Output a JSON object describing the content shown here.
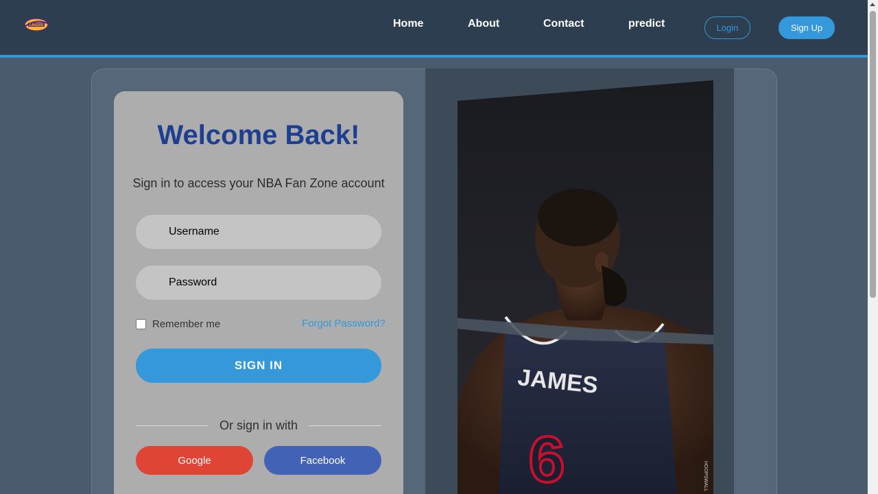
{
  "nav": {
    "links": [
      "Home",
      "About",
      "Contact",
      "predict"
    ],
    "login_label": "Login",
    "signup_label": "Sign Up"
  },
  "login_form": {
    "title": "Welcome Back!",
    "subtitle": "Sign in to access your NBA Fan Zone account",
    "username_placeholder": "Username",
    "password_placeholder": "Password",
    "remember_label": "Remember me",
    "forgot_label": "Forgot Password?",
    "signin_label": "SIGN IN",
    "divider_text": "Or sign in with",
    "google_label": "Google",
    "facebook_label": "Facebook"
  },
  "hero_image": {
    "jersey_name": "JAMES",
    "jersey_number": "6",
    "watermark": "HOOPSWALL"
  },
  "colors": {
    "accent": "#3498db",
    "navbar": "#2c3e50",
    "title": "#1e3f8f",
    "google": "#e04434",
    "facebook": "#4262b5"
  }
}
